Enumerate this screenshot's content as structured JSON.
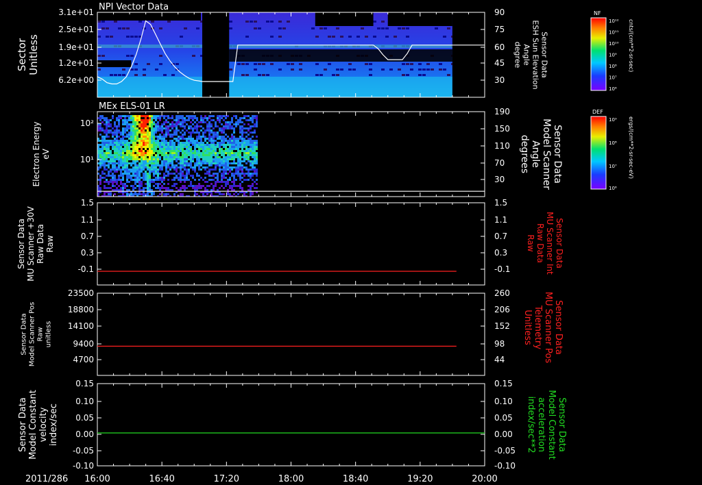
{
  "date_label": "2011/286",
  "time_ticks": [
    "16:00",
    "16:40",
    "17:20",
    "18:00",
    "18:40",
    "19:20",
    "20:00"
  ],
  "colors": {
    "white": "#ffffff",
    "red": "#ff2020",
    "green": "#22dd22"
  },
  "colorbars": [
    {
      "title": "NF",
      "unit": "cnts/(cm**2-sr-sec)",
      "ticks": [
        "10¹²",
        "10¹¹",
        "10¹⁰",
        "10⁹",
        "10⁸",
        "10⁷",
        "10⁶"
      ]
    },
    {
      "title": "DEF",
      "unit": "ergs/(cm**2-sr-sec-eV)",
      "ticks": [
        "10⁹",
        "10⁸",
        "10⁷",
        "10⁶"
      ]
    }
  ],
  "chart_data": [
    {
      "type": "heatmap",
      "title": "NPI Vector Data",
      "ylabel": [
        "Sector",
        "Unitless"
      ],
      "yticks": [
        "3.1e+01",
        "2.5e+01",
        "1.9e+01",
        "1.2e+01",
        "6.2e+00"
      ],
      "y2label": [
        "Sensor Data",
        "ESH Sun Elevation",
        "Angle",
        "degree"
      ],
      "y2ticks": [
        "90",
        "75",
        "60",
        "45",
        "30"
      ],
      "y2lim": [
        20,
        90
      ],
      "x_hours": [
        16,
        20
      ],
      "gap_hours": [
        17.0833,
        17.3611
      ],
      "data_end_hours": [
        19.6667
      ],
      "overlay_line": {
        "name": "ESH Sun Elevation Angle",
        "x": [
          16,
          16.05,
          16.1,
          16.15,
          16.2,
          16.25,
          16.3,
          16.35,
          16.4,
          16.45,
          16.5,
          16.55,
          16.6,
          16.65,
          16.7,
          16.75,
          16.8,
          16.85,
          16.9,
          16.95,
          17.0,
          17.05,
          17.083,
          17.36,
          17.4,
          17.45,
          18.0,
          18.5,
          18.6,
          18.85,
          18.9,
          18.95,
          19.0,
          19.05,
          19.1,
          19.15,
          19.2,
          19.25,
          19.3,
          19.4,
          19.5,
          19.6,
          19.7,
          19.8,
          19.9,
          20.0
        ],
        "y": [
          37,
          35,
          32,
          31,
          31,
          33,
          37,
          45,
          55,
          68,
          83,
          80,
          72,
          64,
          56,
          50,
          45,
          41,
          38,
          35.5,
          34,
          33.5,
          33,
          33,
          33,
          63,
          63,
          63,
          63,
          63,
          60,
          55,
          51,
          51,
          51,
          51,
          56,
          63,
          63,
          63,
          63,
          63,
          63,
          63,
          63,
          63
        ]
      }
    },
    {
      "type": "heatmap",
      "title": "MEx ELS-01 LR",
      "ylabel": [
        "Electron Energy",
        "eV"
      ],
      "yticks": [
        "10²",
        "10¹"
      ],
      "y2label": [
        "Sensor Data",
        "Model Scanner",
        "Angle",
        "degrees"
      ],
      "y2ticks": [
        "190",
        "150",
        "110",
        "70",
        "30"
      ],
      "y2lim": [
        0,
        190
      ],
      "x_hours": [
        16,
        20
      ],
      "data_end_hours": [
        17.646
      ],
      "overlay_line": {
        "name": "Model Scanner Angle",
        "x": [
          16,
          20
        ],
        "y": [
          12,
          12
        ]
      }
    },
    {
      "type": "line",
      "ylabel": [
        "Sensor Data",
        "MU Scanner +30V",
        "Raw Data",
        "Raw"
      ],
      "yticks": [
        "1.5",
        "1.1",
        "0.7",
        "0.3",
        "-0.1"
      ],
      "ylim": [
        -0.3,
        1.5
      ],
      "y2label": [
        "Sensor Data",
        "MU Scanner Int",
        "Raw Data",
        "Raw"
      ],
      "y2ticks": [
        "1.5",
        "1.1",
        "0.7",
        "0.3",
        "-0.1"
      ],
      "y2_color": "red",
      "series": [
        {
          "name": "MU Scanner +30V Raw Data",
          "color": "red",
          "x": [
            16,
            19.7083
          ],
          "y": [
            0,
            0
          ]
        }
      ]
    },
    {
      "type": "line",
      "ylabel": [
        "Sensor Data",
        "Model Scanner Pos",
        "Raw",
        "unitless"
      ],
      "yticks": [
        "23500",
        "18800",
        "14100",
        "9400",
        "4700"
      ],
      "ylim": [
        0,
        23500
      ],
      "y2label": [
        "Sensor Data",
        "MU Scanner Pos",
        "Telemetry",
        "Unitless"
      ],
      "y2ticks": [
        "260",
        "206",
        "152",
        "98",
        "44"
      ],
      "y2_color": "red",
      "series": [
        {
          "name": "Model Scanner Pos",
          "color": "red",
          "x": [
            16,
            19.7083
          ],
          "y": [
            8350,
            8350
          ]
        }
      ]
    },
    {
      "type": "line",
      "ylabel": [
        "Sensor Data",
        "Model Constant",
        "velocity",
        "index/sec"
      ],
      "yticks": [
        "0.15",
        "0.10",
        "0.05",
        "0.00",
        "-0.05",
        "-0.10"
      ],
      "ylim": [
        -0.1,
        0.15
      ],
      "y2label": [
        "Sensor Data",
        "Model Constant",
        "acceleration",
        "index/sec**2"
      ],
      "y2ticks": [
        "0.15",
        "0.10",
        "0.05",
        "0.00",
        "-0.05",
        "-0.10"
      ],
      "y2_color": "green",
      "series": [
        {
          "name": "Model Constant velocity",
          "color": "green",
          "x": [
            16,
            20
          ],
          "y": [
            0,
            0
          ]
        }
      ]
    }
  ]
}
